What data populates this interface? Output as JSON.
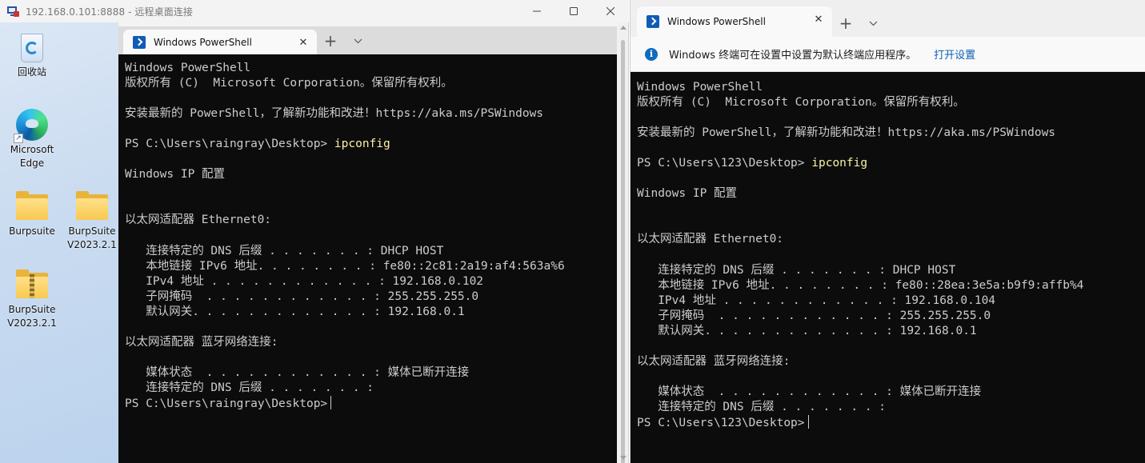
{
  "rdp": {
    "title": "192.168.0.101:8888 - 远程桌面连接",
    "desktop_icons": [
      {
        "label": "回收站"
      },
      {
        "label": "Microsoft Edge"
      },
      {
        "label": "Burpsuite"
      },
      {
        "label": "BurpSuite V2023.2.1"
      },
      {
        "label": "BurpSuite V2023.2.1"
      }
    ]
  },
  "left_ps": {
    "tab_title": "Windows PowerShell",
    "lines": [
      {
        "text": "Windows PowerShell"
      },
      {
        "text": "版权所有 (C)  Microsoft Corporation。保留所有权利。"
      },
      {
        "text": ""
      },
      {
        "text": "安装最新的 PowerShell，了解新功能和改进！https://aka.ms/PSWindows"
      },
      {
        "text": ""
      },
      {
        "prompt": "PS C:\\Users\\raingray\\Desktop> ",
        "cmd": "ipconfig"
      },
      {
        "text": ""
      },
      {
        "text": "Windows IP 配置"
      },
      {
        "text": ""
      },
      {
        "text": ""
      },
      {
        "text": "以太网适配器 Ethernet0:"
      },
      {
        "text": ""
      },
      {
        "text": "   连接特定的 DNS 后缀 . . . . . . . : DHCP HOST"
      },
      {
        "text": "   本地链接 IPv6 地址. . . . . . . . : fe80::2c81:2a19:af4:563a%6"
      },
      {
        "text": "   IPv4 地址 . . . . . . . . . . . . : 192.168.0.102"
      },
      {
        "text": "   子网掩码  . . . . . . . . . . . . : 255.255.255.0"
      },
      {
        "text": "   默认网关. . . . . . . . . . . . . : 192.168.0.1"
      },
      {
        "text": ""
      },
      {
        "text": "以太网适配器 蓝牙网络连接:"
      },
      {
        "text": ""
      },
      {
        "text": "   媒体状态  . . . . . . . . . . . . : 媒体已断开连接"
      },
      {
        "text": "   连接特定的 DNS 后缀 . . . . . . . :"
      },
      {
        "text": "PS C:\\Users\\raingray\\Desktop>",
        "cursor": true
      }
    ]
  },
  "right_ps": {
    "tab_title": "Windows PowerShell",
    "info_text": "Windows 终端可在设置中设置为默认终端应用程序。",
    "info_link": "打开设置",
    "lines": [
      {
        "text": "Windows PowerShell"
      },
      {
        "text": "版权所有 (C)  Microsoft Corporation。保留所有权利。"
      },
      {
        "text": ""
      },
      {
        "text": "安装最新的 PowerShell，了解新功能和改进！https://aka.ms/PSWindows"
      },
      {
        "text": ""
      },
      {
        "prompt": "PS C:\\Users\\123\\Desktop> ",
        "cmd": "ipconfig"
      },
      {
        "text": ""
      },
      {
        "text": "Windows IP 配置"
      },
      {
        "text": ""
      },
      {
        "text": ""
      },
      {
        "text": "以太网适配器 Ethernet0:"
      },
      {
        "text": ""
      },
      {
        "text": "   连接特定的 DNS 后缀 . . . . . . . : DHCP HOST"
      },
      {
        "text": "   本地链接 IPv6 地址. . . . . . . . : fe80::28ea:3e5a:b9f9:affb%4"
      },
      {
        "text": "   IPv4 地址 . . . . . . . . . . . . : 192.168.0.104"
      },
      {
        "text": "   子网掩码  . . . . . . . . . . . . : 255.255.255.0"
      },
      {
        "text": "   默认网关. . . . . . . . . . . . . : 192.168.0.1"
      },
      {
        "text": ""
      },
      {
        "text": "以太网适配器 蓝牙网络连接:"
      },
      {
        "text": ""
      },
      {
        "text": "   媒体状态  . . . . . . . . . . . . : 媒体已断开连接"
      },
      {
        "text": "   连接特定的 DNS 后缀 . . . . . . . :"
      },
      {
        "text": "PS C:\\Users\\123\\Desktop>",
        "cursor": true
      }
    ]
  },
  "icons": {
    "close": "✕",
    "plus": "+",
    "chevron": "⌄",
    "minimize": "—",
    "maximize": "☐",
    "info": "i"
  },
  "colors": {
    "terminal_bg": "#0c0c0c",
    "terminal_fg": "#cccccc",
    "command_fg": "#f9f1a5",
    "link": "#0f5fb8"
  }
}
